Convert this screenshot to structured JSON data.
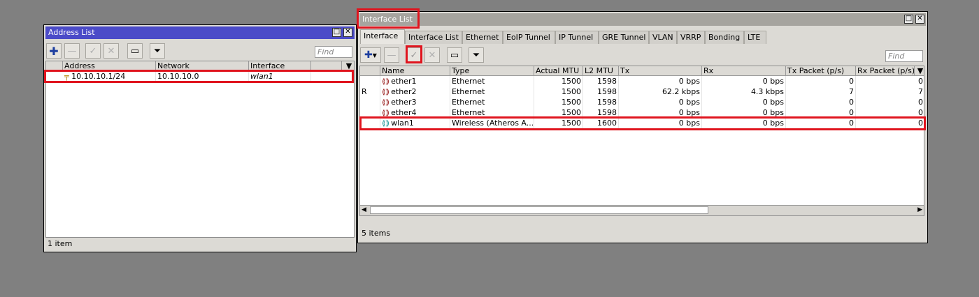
{
  "address_list": {
    "title": "Address List",
    "find_placeholder": "Find",
    "columns": [
      "Address",
      "Network",
      "Interface"
    ],
    "rows": [
      {
        "address": "10.10.10.1/24",
        "network": "10.10.10.0",
        "interface": "wlan1"
      }
    ],
    "status": "1 item"
  },
  "interface_list": {
    "title": "Interface List",
    "tabs": [
      "Interface",
      "Interface List",
      "Ethernet",
      "EoIP Tunnel",
      "IP Tunnel",
      "GRE Tunnel",
      "VLAN",
      "VRRP",
      "Bonding",
      "LTE"
    ],
    "find_placeholder": "Find",
    "columns": [
      "Name",
      "Type",
      "Actual MTU",
      "L2 MTU",
      "Tx",
      "Rx",
      "Tx Packet (p/s)",
      "Rx Packet (p/s)"
    ],
    "rows": [
      {
        "flag": "",
        "name": "ether1",
        "type": "Ethernet",
        "actual_mtu": "1500",
        "l2_mtu": "1598",
        "tx": "0 bps",
        "rx": "0 bps",
        "tx_pkt": "0",
        "rx_pkt": "0"
      },
      {
        "flag": "R",
        "name": "ether2",
        "type": "Ethernet",
        "actual_mtu": "1500",
        "l2_mtu": "1598",
        "tx": "62.2 kbps",
        "rx": "4.3 kbps",
        "tx_pkt": "7",
        "rx_pkt": "7"
      },
      {
        "flag": "",
        "name": "ether3",
        "type": "Ethernet",
        "actual_mtu": "1500",
        "l2_mtu": "1598",
        "tx": "0 bps",
        "rx": "0 bps",
        "tx_pkt": "0",
        "rx_pkt": "0"
      },
      {
        "flag": "",
        "name": "ether4",
        "type": "Ethernet",
        "actual_mtu": "1500",
        "l2_mtu": "1598",
        "tx": "0 bps",
        "rx": "0 bps",
        "tx_pkt": "0",
        "rx_pkt": "0"
      },
      {
        "flag": "",
        "name": "wlan1",
        "type": "Wireless (Atheros A...",
        "actual_mtu": "1500",
        "l2_mtu": "1600",
        "tx": "0 bps",
        "rx": "0 bps",
        "tx_pkt": "0",
        "rx_pkt": "0"
      }
    ],
    "status": "5 items"
  },
  "colors": {
    "active_title": "#4b4bc8",
    "inactive_title": "#a6a49f",
    "highlight": "#e0141e"
  }
}
